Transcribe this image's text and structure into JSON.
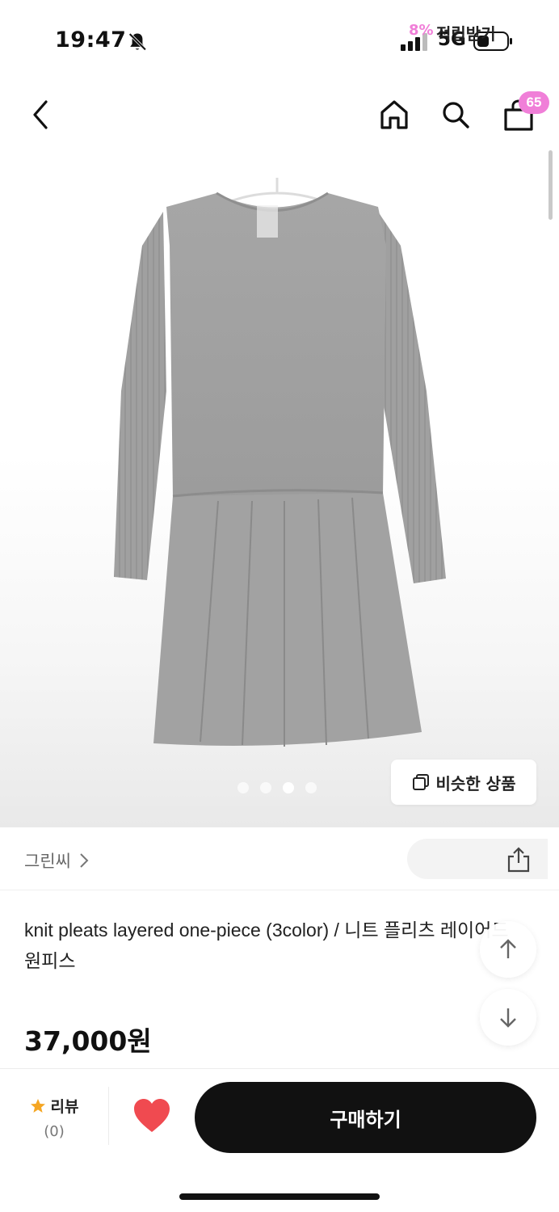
{
  "status_bar": {
    "time": "19:47",
    "network": "5G"
  },
  "nav": {
    "cart_badge": "65"
  },
  "image": {
    "similar_button_label": "비슷한 상품",
    "dots_count": 4,
    "active_dot_index": 2
  },
  "brand": {
    "name": "그린씨",
    "points_percent": "8%",
    "points_label": "적립받기"
  },
  "product": {
    "title": "knit pleats layered one-piece (3color) / 니트 플리츠 레이어드 원피스",
    "price": "37,000원"
  },
  "bottom_bar": {
    "review_label": "리뷰",
    "review_count": "(0)",
    "buy_label": "구매하기"
  },
  "colors": {
    "accent_pink": "#f07fd8",
    "buy_bg": "#111111",
    "heart": "#f04a50",
    "star": "#f5a623"
  }
}
